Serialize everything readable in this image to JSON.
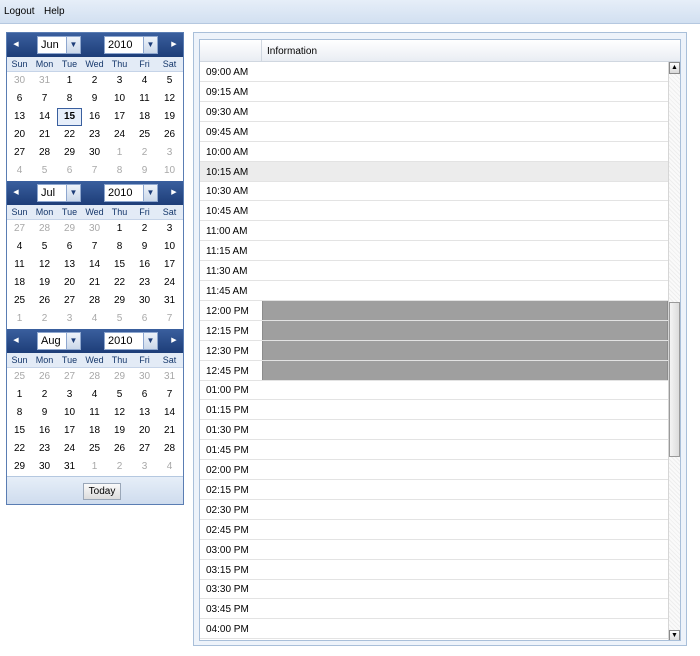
{
  "menu": {
    "logout": "Logout",
    "help": "Help"
  },
  "calendar": {
    "days_of_week": [
      "Sun",
      "Mon",
      "Tue",
      "Wed",
      "Thu",
      "Fri",
      "Sat"
    ],
    "today_label": "Today",
    "months": [
      {
        "month": "Jun",
        "year": "2010",
        "days": [
          "30",
          "31",
          "1",
          "2",
          "3",
          "4",
          "5",
          "6",
          "7",
          "8",
          "9",
          "10",
          "11",
          "12",
          "13",
          "14",
          "15",
          "16",
          "17",
          "18",
          "19",
          "20",
          "21",
          "22",
          "23",
          "24",
          "25",
          "26",
          "27",
          "28",
          "29",
          "30",
          "1",
          "2",
          "3",
          "4",
          "5",
          "6",
          "7",
          "8",
          "9",
          "10"
        ],
        "other_month": [
          0,
          1,
          32,
          33,
          34,
          35,
          36,
          37,
          38,
          39,
          40,
          41
        ],
        "selected_index": 16
      },
      {
        "month": "Jul",
        "year": "2010",
        "days": [
          "27",
          "28",
          "29",
          "30",
          "1",
          "2",
          "3",
          "4",
          "5",
          "6",
          "7",
          "8",
          "9",
          "10",
          "11",
          "12",
          "13",
          "14",
          "15",
          "16",
          "17",
          "18",
          "19",
          "20",
          "21",
          "22",
          "23",
          "24",
          "25",
          "26",
          "27",
          "28",
          "29",
          "30",
          "31",
          "1",
          "2",
          "3",
          "4",
          "5",
          "6",
          "7"
        ],
        "other_month": [
          0,
          1,
          2,
          3,
          35,
          36,
          37,
          38,
          39,
          40,
          41
        ],
        "selected_index": -1
      },
      {
        "month": "Aug",
        "year": "2010",
        "days": [
          "25",
          "26",
          "27",
          "28",
          "29",
          "30",
          "31",
          "1",
          "2",
          "3",
          "4",
          "5",
          "6",
          "7",
          "8",
          "9",
          "10",
          "11",
          "12",
          "13",
          "14",
          "15",
          "16",
          "17",
          "18",
          "19",
          "20",
          "21",
          "22",
          "23",
          "24",
          "25",
          "26",
          "27",
          "28",
          "29",
          "30",
          "31",
          "1",
          "2",
          "3",
          "4"
        ],
        "other_month": [
          0,
          1,
          2,
          3,
          4,
          5,
          6,
          38,
          39,
          40,
          41
        ],
        "selected_index": -1
      }
    ]
  },
  "schedule": {
    "column_header": "Information",
    "times": [
      "09:00 AM",
      "09:15 AM",
      "09:30 AM",
      "09:45 AM",
      "10:00 AM",
      "10:15 AM",
      "10:30 AM",
      "10:45 AM",
      "11:00 AM",
      "11:15 AM",
      "11:30 AM",
      "11:45 AM",
      "12:00 PM",
      "12:15 PM",
      "12:30 PM",
      "12:45 PM",
      "01:00 PM",
      "01:15 PM",
      "01:30 PM",
      "01:45 PM",
      "02:00 PM",
      "02:15 PM",
      "02:30 PM",
      "02:45 PM",
      "03:00 PM",
      "03:15 PM",
      "03:30 PM",
      "03:45 PM",
      "04:00 PM"
    ],
    "highlighted_row": 5,
    "booked_rows": [
      12,
      13,
      14,
      15
    ]
  }
}
